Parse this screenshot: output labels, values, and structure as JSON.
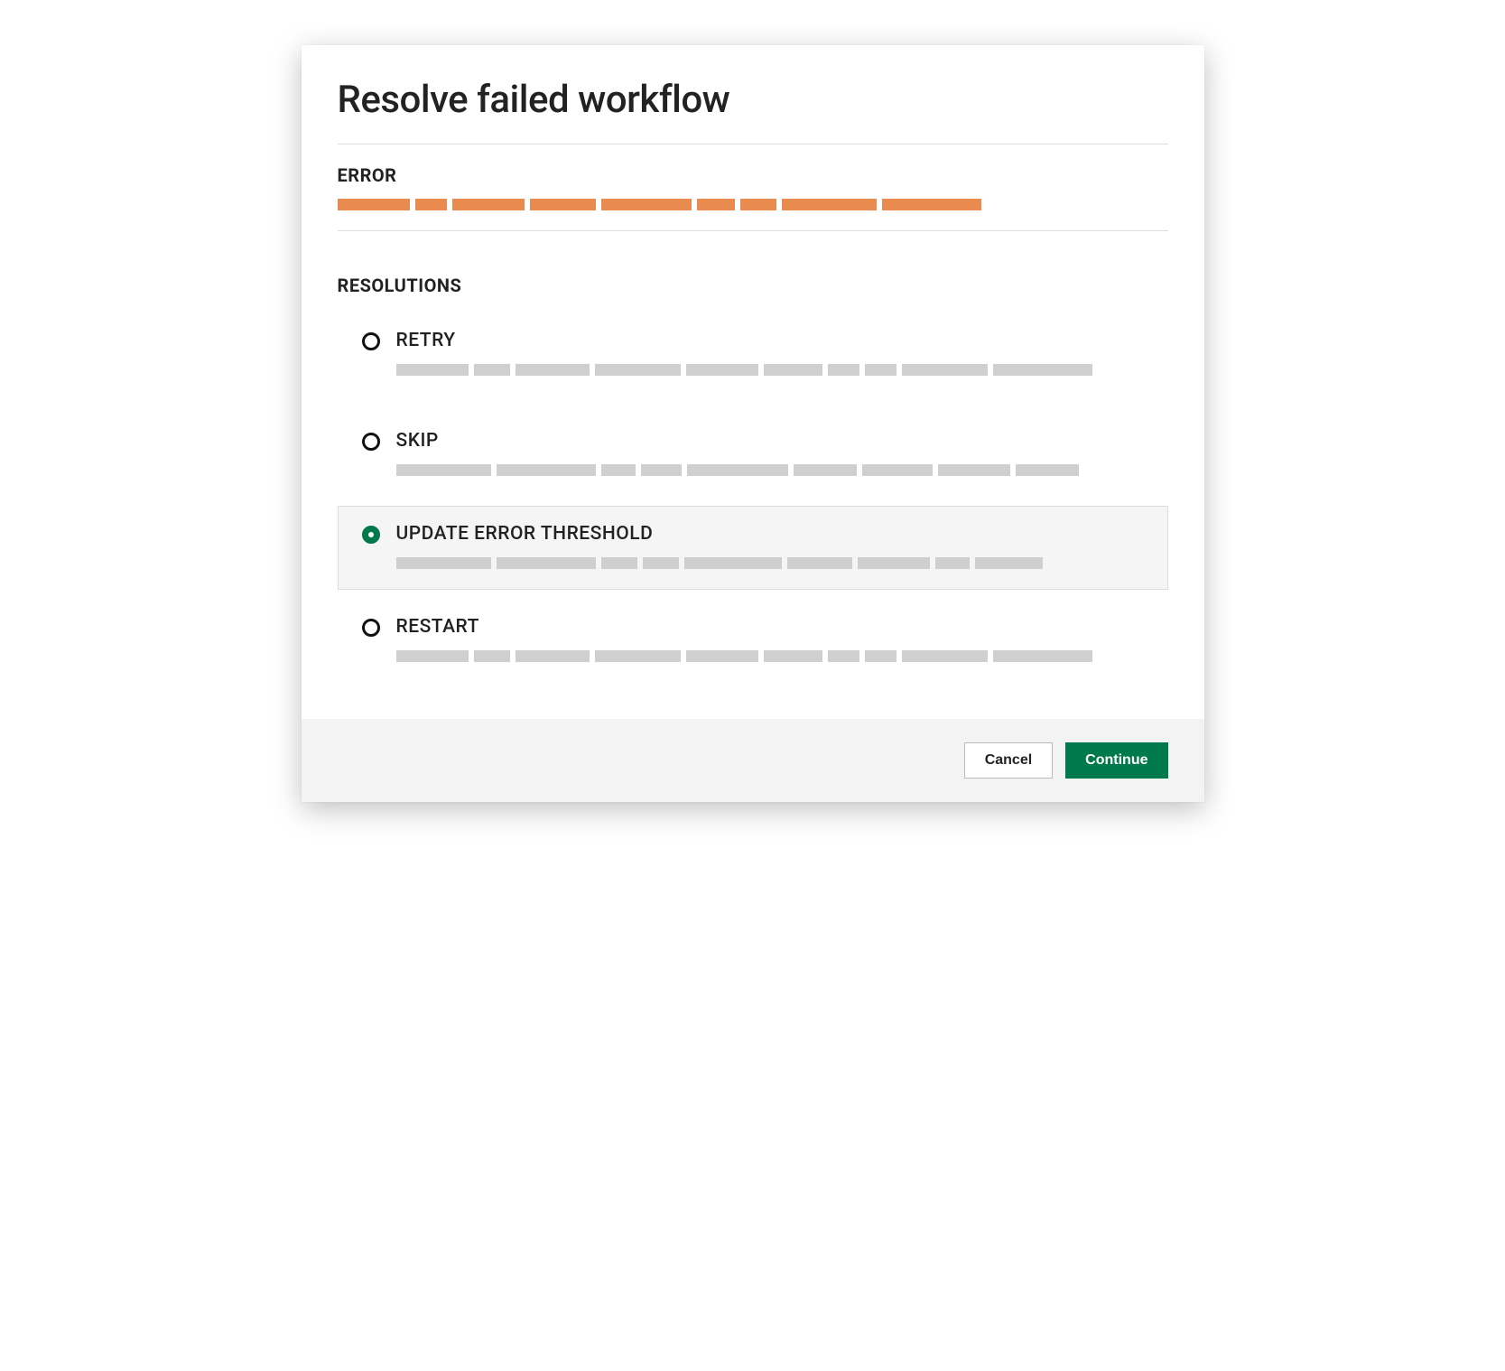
{
  "dialog": {
    "title": "Resolve failed workflow",
    "error_label": "ERROR",
    "error_bar_widths": [
      80,
      35,
      80,
      73,
      100,
      42,
      40,
      105,
      110
    ],
    "resolutions_label": "RESOLUTIONS",
    "options": [
      {
        "key": "retry",
        "label": "RETRY",
        "selected": false,
        "desc_bar_widths": [
          80,
          40,
          82,
          95,
          80,
          65,
          35,
          35,
          95,
          110
        ]
      },
      {
        "key": "skip",
        "label": "SKIP",
        "selected": false,
        "desc_bar_widths": [
          105,
          110,
          38,
          45,
          112,
          70,
          78,
          80,
          70
        ]
      },
      {
        "key": "update-error-threshold",
        "label": "UPDATE ERROR THRESHOLD",
        "selected": true,
        "desc_bar_widths": [
          105,
          110,
          40,
          40,
          108,
          72,
          80,
          38,
          75
        ]
      },
      {
        "key": "restart",
        "label": "RESTART",
        "selected": false,
        "desc_bar_widths": [
          80,
          40,
          82,
          95,
          80,
          65,
          35,
          35,
          95,
          110
        ]
      }
    ],
    "footer": {
      "cancel_label": "Cancel",
      "continue_label": "Continue"
    }
  }
}
